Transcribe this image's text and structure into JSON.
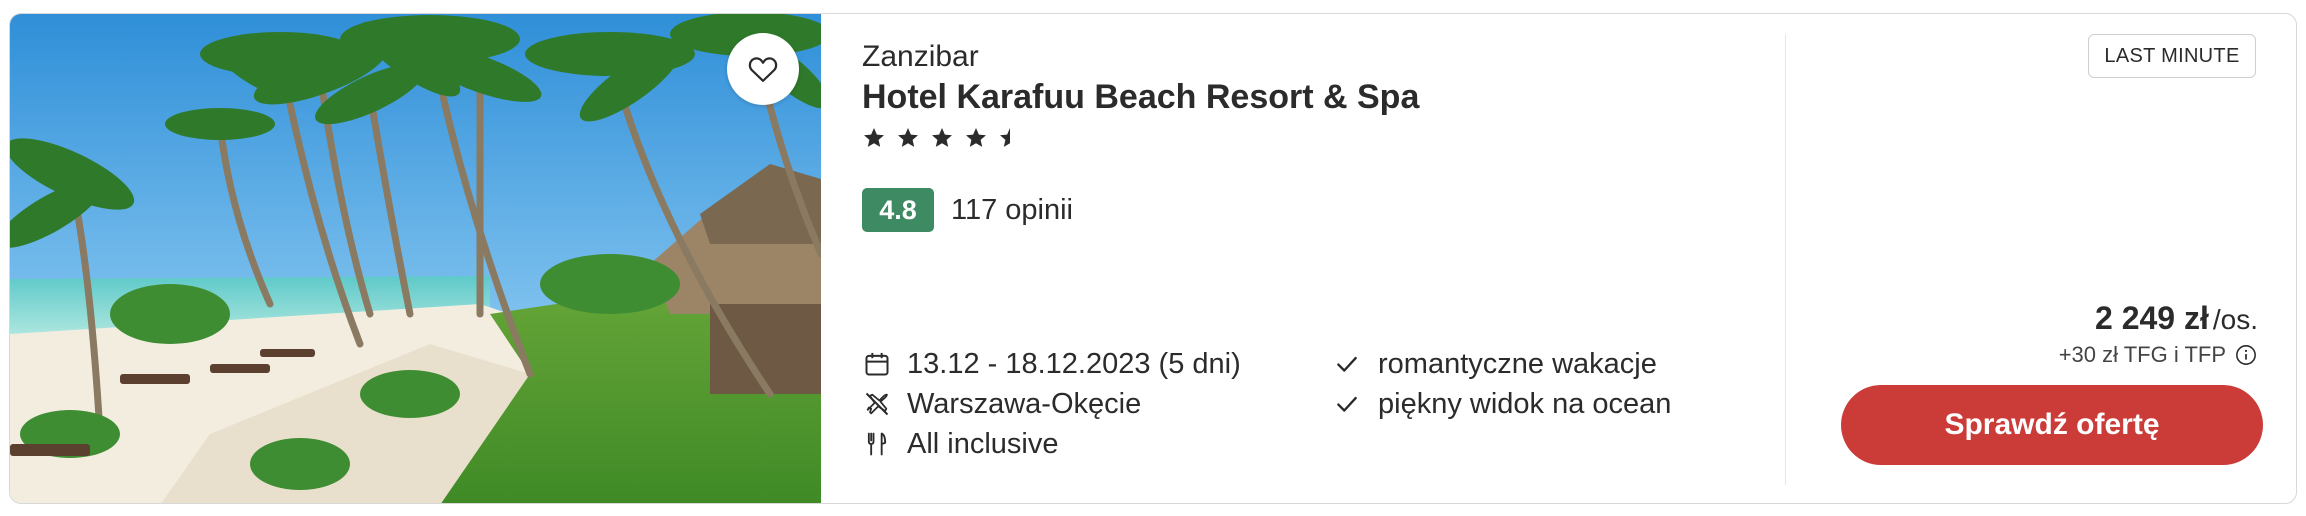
{
  "offer": {
    "location": "Zanzibar",
    "hotel_name": "Hotel Karafuu Beach Resort & Spa",
    "stars": 4.5,
    "rating": "4.8",
    "reviews": "117 opinii",
    "dates": "13.12 - 18.12.2023 (5 dni)",
    "departure": "Warszawa-Okęcie",
    "board": "All inclusive",
    "features": [
      "romantyczne wakacje",
      "piękny widok na ocean"
    ],
    "badge": "LAST MINUTE",
    "price": "2 249 zł",
    "price_unit": "/os.",
    "extra_fees": "+30 zł TFG i TFP",
    "cta_label": "Sprawdź ofertę"
  },
  "icons": {
    "favorite": "heart-outline-icon",
    "star": "star-icon",
    "calendar": "calendar-icon",
    "departure": "plane-slash-icon",
    "board": "fork-knife-icon",
    "check": "check-icon",
    "info": "info-circle-icon"
  },
  "colors": {
    "rating_badge": "#3d8a63",
    "cta": "#cb3b37",
    "text": "#2b2b2b"
  }
}
